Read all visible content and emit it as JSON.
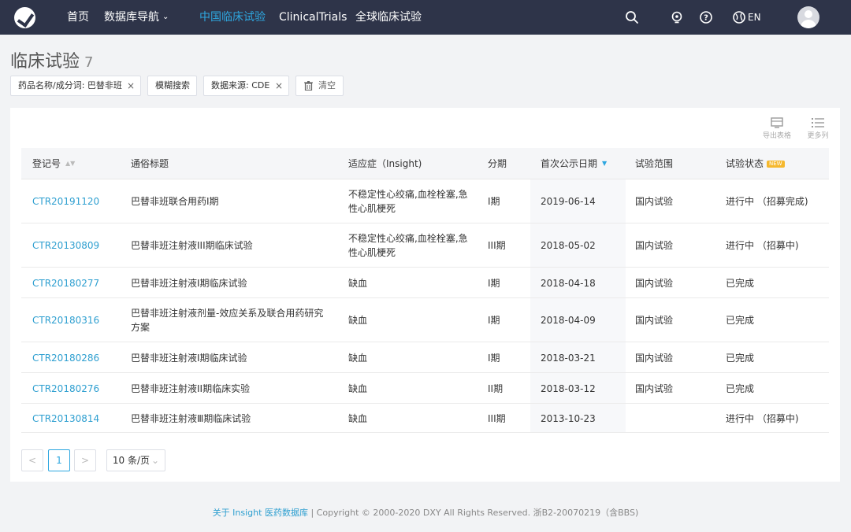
{
  "nav": {
    "home": "首页",
    "db_nav": "数据库导航",
    "cn_trials": "中国临床试验",
    "clinical_trials": "ClinicalTrials",
    "global_trials": "全球临床试验",
    "lang": "EN",
    "icons": [
      "search-icon",
      "lightbulb-icon",
      "help-icon",
      "globe-icon",
      "avatar"
    ]
  },
  "page": {
    "title": "临床试验",
    "count": "7"
  },
  "filters": {
    "drug": "药品名称/成分词: 巴替非班",
    "fuzzy": "模糊搜索",
    "source": "数据来源: CDE",
    "clear": "清空",
    "remove_symbol": "×"
  },
  "tools": {
    "export": "导出表格",
    "more_cols": "更多列"
  },
  "table": {
    "headers": {
      "reg_no": "登记号",
      "title": "通俗标题",
      "indication": "适应症（Insight)",
      "phase": "分期",
      "first_date": "首次公示日期",
      "scope": "试验范围",
      "status": "试验状态",
      "new_badge": "NEW"
    },
    "rows": [
      {
        "reg_no": "CTR20191120",
        "title": "巴替非班联合用药I期",
        "indication": "不稳定性心绞痛,血栓栓塞,急性心肌梗死",
        "phase": "I期",
        "date": "2019-06-14",
        "scope": "国内试验",
        "status": "进行中 （招募完成)"
      },
      {
        "reg_no": "CTR20130809",
        "title": "巴替非班注射液III期临床试验",
        "indication": "不稳定性心绞痛,血栓栓塞,急性心肌梗死",
        "phase": "III期",
        "date": "2018-05-02",
        "scope": "国内试验",
        "status": "进行中 （招募中)"
      },
      {
        "reg_no": "CTR20180277",
        "title": "巴替非班注射液I期临床试验",
        "indication": "缺血",
        "phase": "I期",
        "date": "2018-04-18",
        "scope": "国内试验",
        "status": "已完成"
      },
      {
        "reg_no": "CTR20180316",
        "title": "巴替非班注射液剂量-效应关系及联合用药研究方案",
        "indication": "缺血",
        "phase": "I期",
        "date": "2018-04-09",
        "scope": "国内试验",
        "status": "已完成"
      },
      {
        "reg_no": "CTR20180286",
        "title": "巴替非班注射液I期临床试验",
        "indication": "缺血",
        "phase": "I期",
        "date": "2018-03-21",
        "scope": "国内试验",
        "status": "已完成"
      },
      {
        "reg_no": "CTR20180276",
        "title": "巴替非班注射液II期临床实验",
        "indication": "缺血",
        "phase": "II期",
        "date": "2018-03-12",
        "scope": "国内试验",
        "status": "已完成"
      },
      {
        "reg_no": "CTR20130814",
        "title": "巴替非班注射液Ⅲ期临床试验",
        "indication": "缺血",
        "phase": "III期",
        "date": "2013-10-23",
        "scope": "",
        "status": "进行中 （招募中)"
      }
    ]
  },
  "pagination": {
    "prev": "<",
    "current": "1",
    "next": ">",
    "page_size": "10 条/页"
  },
  "footer": {
    "link": "关于 Insight 医药数据库",
    "separator": "|",
    "copyright": "Copyright © 2000-2020 DXY All Rights Reserved. 浙B2-20070219（含BBS)"
  },
  "colors": {
    "nav_bg": "#2e3449",
    "accent": "#2ea7e0",
    "link": "#2e9fd0",
    "badge": "#f5b82e"
  }
}
